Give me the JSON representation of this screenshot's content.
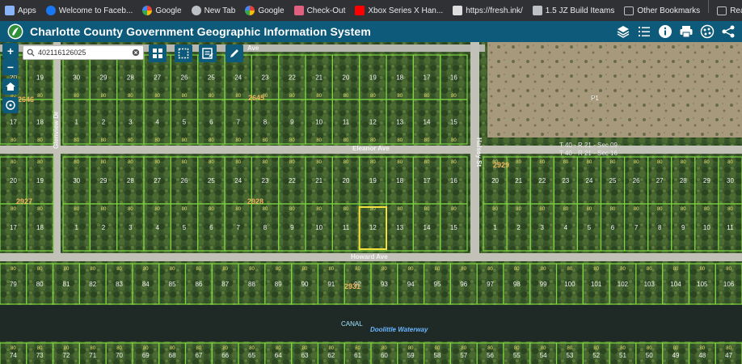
{
  "bookmarks": [
    {
      "label": "Apps",
      "icon": "apps-grid-icon",
      "color": "#8ab4f8"
    },
    {
      "label": "Welcome to Faceb...",
      "icon": "facebook-icon",
      "color": "#1877f2"
    },
    {
      "label": "Google",
      "icon": "google-icon",
      "color": "#ffffff"
    },
    {
      "label": "New Tab",
      "icon": "globe-icon",
      "color": "#bdc1c6"
    },
    {
      "label": "Google",
      "icon": "google-icon",
      "color": "#ffffff"
    },
    {
      "label": "Check-Out",
      "icon": "checkout-icon",
      "color": "#e06080"
    },
    {
      "label": "Xbox Series X Han...",
      "icon": "youtube-icon",
      "color": "#ff0000"
    },
    {
      "label": "https://fresh.ink/",
      "icon": "fresh-ink-icon",
      "color": "#dddddd"
    },
    {
      "label": "1.5 JZ Build Iteams",
      "icon": "folder-icon",
      "color": "#bdc1c6"
    }
  ],
  "bookmarks_right": [
    {
      "label": "Other Bookmarks",
      "icon": "folder-icon"
    },
    {
      "label": "Reading List",
      "icon": "reading-list-icon"
    }
  ],
  "app": {
    "title": "Charlotte County Government Geographic Information System",
    "header_color": "#0e5a7a",
    "header_icons": [
      "layers-icon",
      "list-icon",
      "info-icon",
      "print-icon",
      "gallery-icon",
      "share-icon"
    ]
  },
  "search": {
    "value": "402116126025"
  },
  "map": {
    "roads": {
      "top": "Ave",
      "eleanor": "Eleanor Ave",
      "howard": "Howard Ave",
      "halsey": "Halsey St",
      "glenview": "Glenview Dr"
    },
    "blocks": {
      "b2646": "2646",
      "b2645": "2645",
      "b2928": "2928",
      "b2927": "2927",
      "b2929": "2929",
      "b2931": "2931"
    },
    "section_labels": {
      "line1": "T 40 - R 21 - Sec 09",
      "line2": "T 40 - R 21 - Sec 16"
    },
    "canal_label": "CANAL",
    "waterway_label": "Doolittle Waterway",
    "p1": "P1",
    "block2645_lots": {
      "top": [
        "30",
        "29",
        "28",
        "27",
        "26",
        "25",
        "24",
        "23",
        "22",
        "21",
        "20",
        "19",
        "18",
        "17",
        "16"
      ],
      "bottom": [
        "1",
        "2",
        "3",
        "4",
        "5",
        "6",
        "7",
        "8",
        "9",
        "10",
        "11",
        "12",
        "13",
        "14",
        "15"
      ]
    },
    "block2928_lots": {
      "top": [
        "30",
        "29",
        "28",
        "27",
        "26",
        "25",
        "24",
        "23",
        "22",
        "21",
        "20",
        "19",
        "18",
        "17",
        "16"
      ],
      "bottom": [
        "1",
        "2",
        "3",
        "4",
        "5",
        "6",
        "7",
        "8",
        "9",
        "10",
        "11",
        "12",
        "13",
        "14",
        "15"
      ]
    },
    "block2646_lots": {
      "top": [
        "20",
        "19"
      ],
      "bottom": [
        "17",
        "18"
      ]
    },
    "block2927_lots": {
      "top": [
        "20",
        "19"
      ],
      "bottom": [
        "17",
        "18"
      ]
    },
    "block2929_lots": {
      "top": [
        "20",
        "21",
        "22",
        "23",
        "24",
        "25",
        "26",
        "27",
        "28",
        "29",
        "30"
      ],
      "bottom": [
        "1",
        "2",
        "3",
        "4",
        "5",
        "6",
        "7",
        "8",
        "9"
      ]
    },
    "block2931_lots": [
      "79",
      "80",
      "81",
      "82",
      "83",
      "84",
      "85",
      "86",
      "87",
      "88",
      "89",
      "90",
      "91",
      "92",
      "93",
      "94",
      "95",
      "96",
      "97",
      "98",
      "99",
      "100",
      "101",
      "102",
      "103",
      "104",
      "105",
      "106"
    ],
    "canal_south_lots": [
      "74",
      "73",
      "72",
      "71",
      "70",
      "69",
      "68",
      "67",
      "66",
      "65",
      "64",
      "63",
      "62",
      "61",
      "60",
      "59",
      "58",
      "57",
      "56",
      "55",
      "54",
      "53",
      "52",
      "51",
      "50",
      "49",
      "48",
      "47"
    ],
    "selected_lot": "12",
    "frontage": "80"
  }
}
